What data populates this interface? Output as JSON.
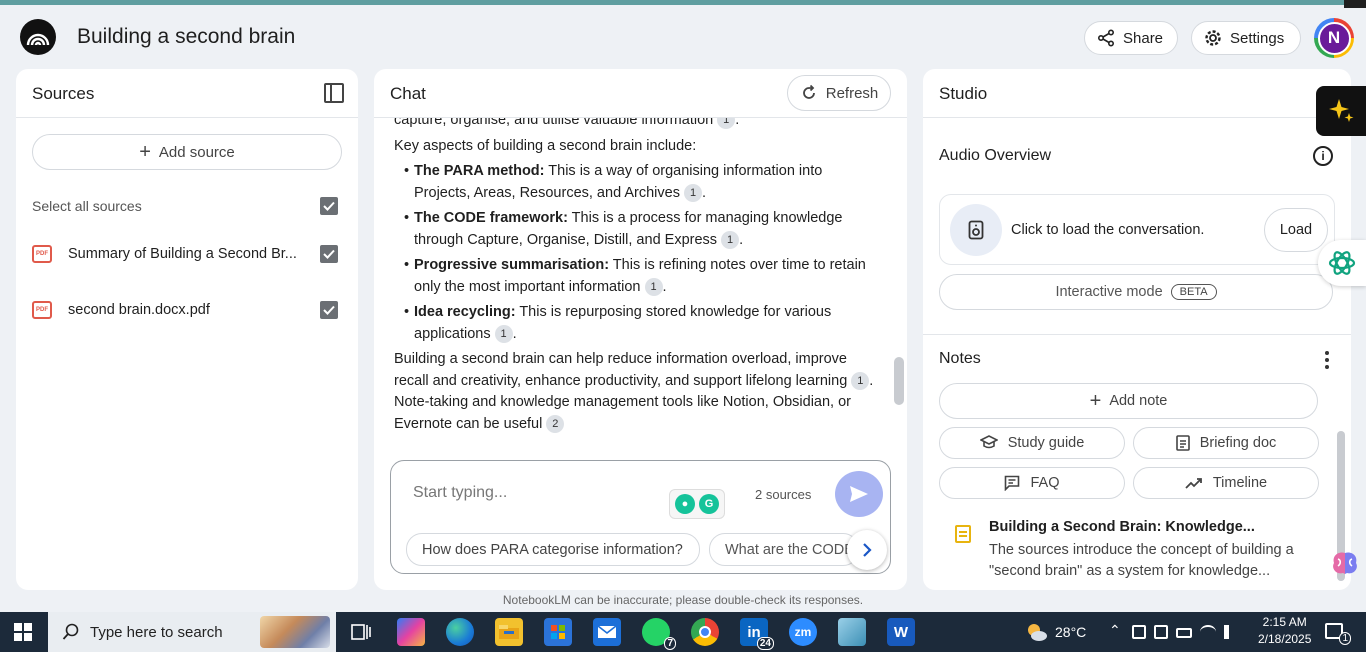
{
  "header": {
    "title": "Building a second brain",
    "share_label": "Share",
    "settings_label": "Settings",
    "avatar_initial": "N"
  },
  "sources": {
    "title": "Sources",
    "add_label": "Add source",
    "select_all_label": "Select all sources",
    "items": [
      {
        "label": "Summary of Building a Second Br...",
        "checked": true,
        "icon": "pdf-icon"
      },
      {
        "label": "second brain.docx.pdf",
        "checked": true,
        "icon": "pdf-icon"
      }
    ],
    "pdf_badge": "PDF"
  },
  "chat": {
    "title": "Chat",
    "refresh_label": "Refresh",
    "top_partial": "capture, organise, and utilise valuable information",
    "intro": "Key aspects of building a second brain include:",
    "bullets": [
      {
        "bold": "The PARA method:",
        "text": " This is a way of organising information into Projects, Areas, Resources, and Archives",
        "cite": "1"
      },
      {
        "bold": "The CODE framework:",
        "text": " This is a process for managing knowledge through Capture, Organise, Distill, and Express",
        "cite": "1"
      },
      {
        "bold": "Progressive summarisation:",
        "text": " This is refining notes over time to retain only the most important information",
        "cite": "1"
      },
      {
        "bold": "Idea recycling:",
        "text": " This is repurposing stored knowledge for various applications",
        "cite": "1"
      }
    ],
    "para_part1": "Building a second brain can help reduce information overload, improve recall and creativity, enhance productivity, and support lifelong learning",
    "para_cite1": "1",
    "para_part2": ". Note-taking and knowledge management tools like Notion, Obsidian, or Evernote can be useful",
    "para_cite2": "2",
    "top_cite": "1",
    "input_placeholder": "Start typing...",
    "source_count": "2 sources",
    "suggestions": [
      "How does PARA categorise information?",
      "What are the CODE"
    ],
    "grammarly_letter": "G"
  },
  "studio": {
    "title": "Studio",
    "audio_title": "Audio Overview",
    "audio_text": "Click to load the conversation.",
    "load_label": "Load",
    "interactive_label": "Interactive mode",
    "beta_label": "BETA",
    "notes_title": "Notes",
    "add_note_label": "Add note",
    "buttons": [
      "Study guide",
      "Briefing doc",
      "FAQ",
      "Timeline"
    ],
    "note": {
      "title": "Building a Second Brain: Knowledge...",
      "desc": "The sources introduce the concept of building a \"second brain\" as a system for knowledge..."
    },
    "info_glyph": "i"
  },
  "disclaimer": "NotebookLM can be inaccurate; please double-check its responses.",
  "taskbar": {
    "search_placeholder": "Type here to search",
    "weather": "28°C",
    "time": "2:15 AM",
    "date": "2/18/2025",
    "whatsapp_badge": "7",
    "linkedin_badge": "24",
    "notif_badge": "1",
    "zoom_label": "zm",
    "linkedin_label": "in",
    "word_label": "W"
  },
  "colors": {
    "accent": "#a8b4f2",
    "avatar_bg": "#6a1b9a",
    "taskbar": "#1c2a3a"
  }
}
